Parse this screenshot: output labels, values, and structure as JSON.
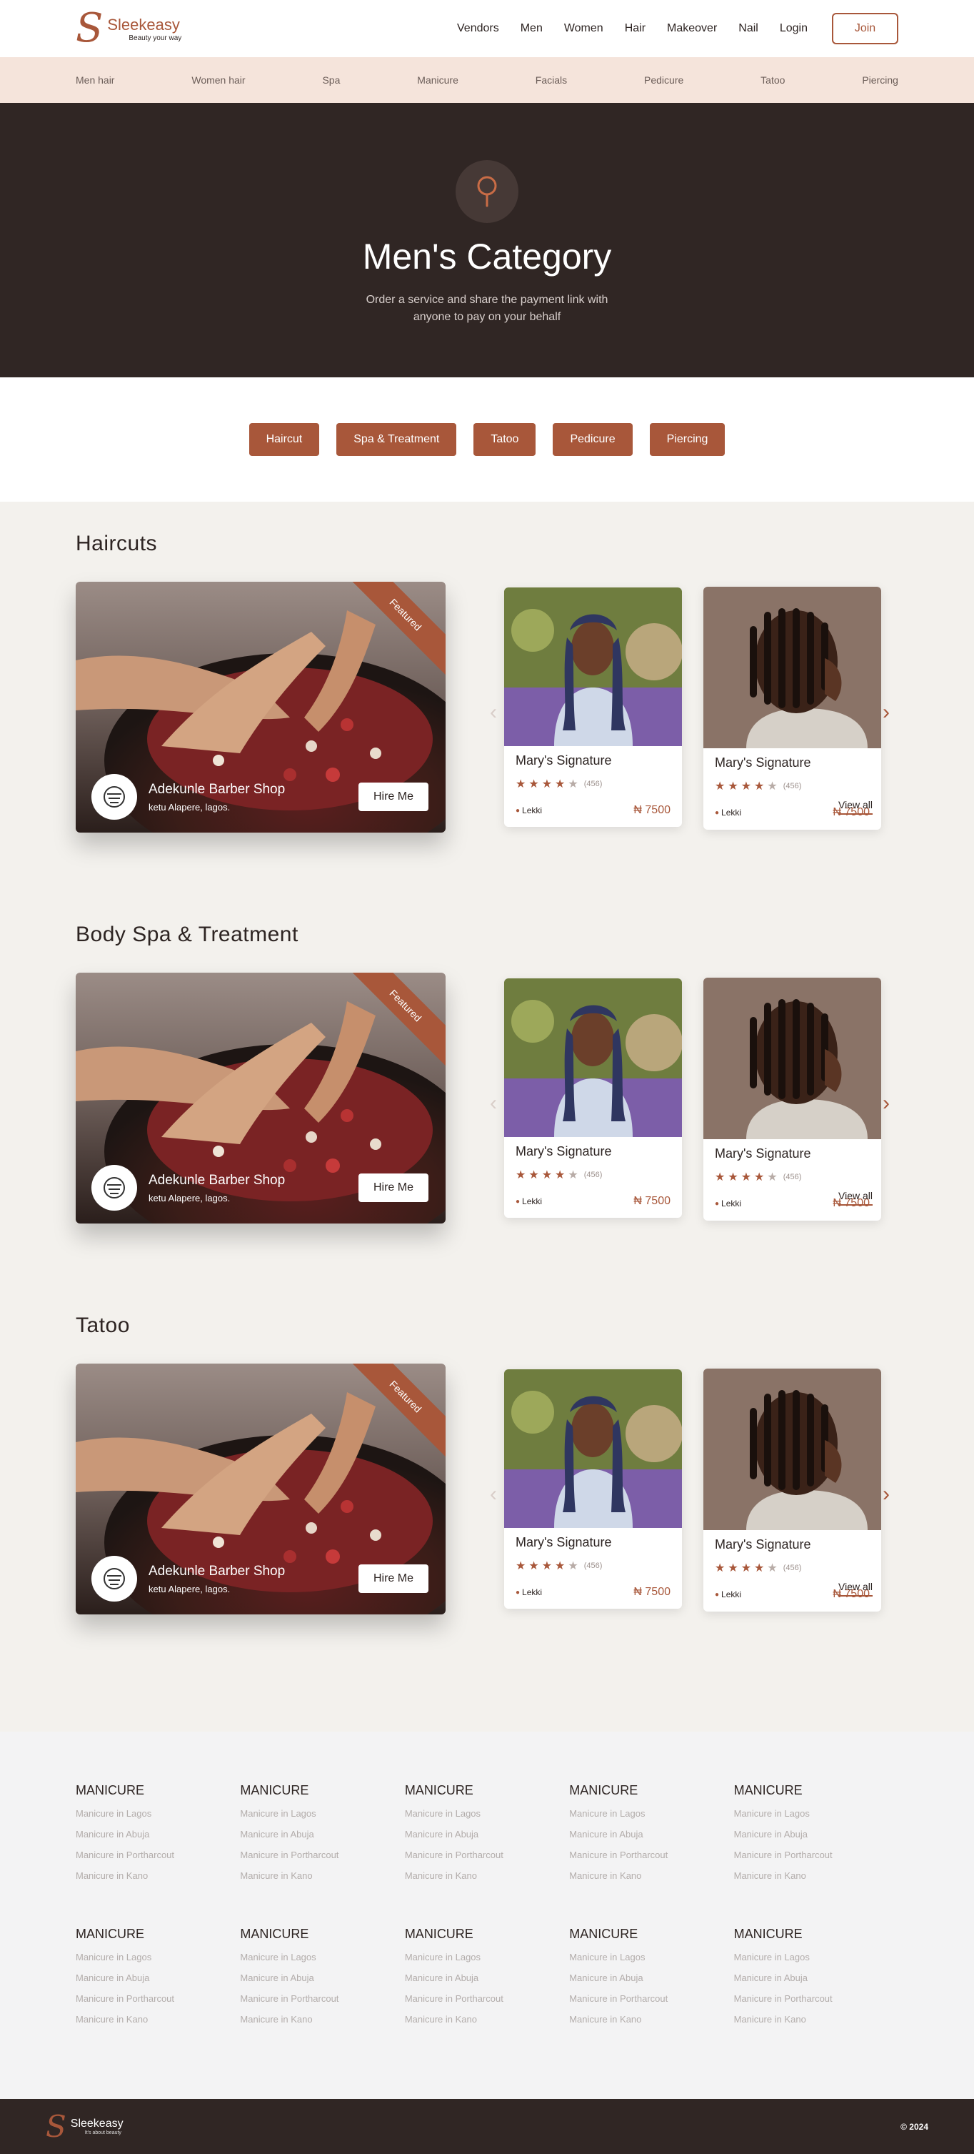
{
  "brand": {
    "name": "Sleekeasy",
    "tagline": "Beauty your way",
    "footer_tagline": "It's about beauty"
  },
  "nav": {
    "links": [
      "Vendors",
      "Men",
      "Women",
      "Hair",
      "Makeover",
      "Nail",
      "Login"
    ],
    "join": "Join"
  },
  "categories": [
    "Men hair",
    "Women hair",
    "Spa",
    "Manicure",
    "Facials",
    "Pedicure",
    "Tatoo",
    "Piercing"
  ],
  "hero": {
    "title": "Men's Category",
    "subtitle": "Order a service and share the payment link with anyone to pay on your behalf"
  },
  "filters": [
    "Haircut",
    "Spa & Treatment",
    "Tatoo",
    "Pedicure",
    "Piercing"
  ],
  "sections": [
    {
      "title": "Haircuts",
      "featured": {
        "ribbon": "Featured",
        "name": "Adekunle Barber Shop",
        "location": "ketu Alapere, lagos.",
        "hire": "Hire Me"
      },
      "cards": [
        {
          "title": "Mary's Signature",
          "rating": 4,
          "count": "(456)",
          "location": "Lekki",
          "price": "₦ 7500"
        },
        {
          "title": "Mary's Signature",
          "rating": 4,
          "count": "(456)",
          "location": "Lekki",
          "price": "₦ 7500"
        }
      ],
      "view_all": "View all"
    },
    {
      "title": "Body Spa & Treatment",
      "featured": {
        "ribbon": "Featured",
        "name": "Adekunle Barber Shop",
        "location": "ketu Alapere, lagos.",
        "hire": "Hire Me"
      },
      "cards": [
        {
          "title": "Mary's Signature",
          "rating": 4,
          "count": "(456)",
          "location": "Lekki",
          "price": "₦ 7500"
        },
        {
          "title": "Mary's Signature",
          "rating": 4,
          "count": "(456)",
          "location": "Lekki",
          "price": "₦ 7500"
        }
      ],
      "view_all": "View all"
    },
    {
      "title": "Tatoo",
      "featured": {
        "ribbon": "Featured",
        "name": "Adekunle Barber Shop",
        "location": "ketu Alapere, lagos.",
        "hire": "Hire Me"
      },
      "cards": [
        {
          "title": "Mary's Signature",
          "rating": 4,
          "count": "(456)",
          "location": "Lekki",
          "price": "₦ 7500"
        },
        {
          "title": "Mary's Signature",
          "rating": 4,
          "count": "(456)",
          "location": "Lekki",
          "price": "₦ 7500"
        }
      ],
      "view_all": "View all"
    }
  ],
  "footer_columns": {
    "heading": "MANICURE",
    "items": [
      "Manicure in Lagos",
      "Manicure in Abuja",
      "Manicure in Portharcout",
      "Manicure in Kano"
    ]
  },
  "copyright": "© 2024",
  "colors": {
    "accent": "#a8573a",
    "dark": "#302624",
    "strip": "#f5e4db"
  }
}
